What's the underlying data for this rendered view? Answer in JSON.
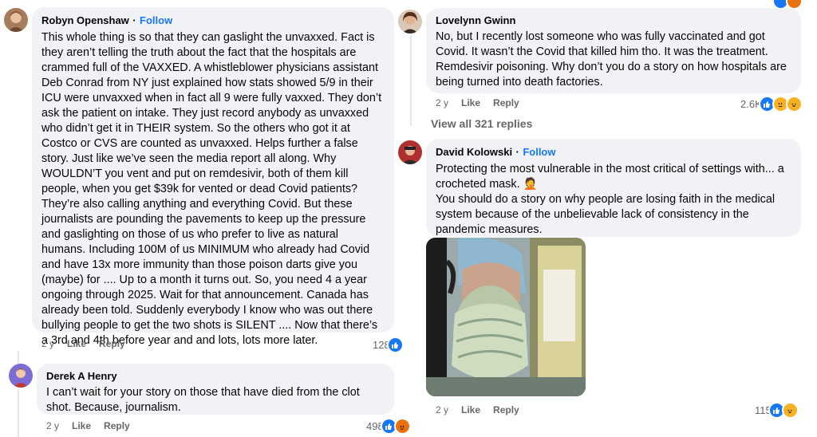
{
  "comments": {
    "robyn": {
      "author": "Robyn Openshaw",
      "separator": "·",
      "follow": "Follow",
      "text": "This whole thing is so that they can gaslight the unvaxxed. Fact is they aren’t telling the truth about the fact that the hospitals are crammed full of the VAXXED. A whistleblower physicians assistant Deb Conrad from NY just explained how stats showed 5/9 in their ICU were unvaxxed when in fact all 9 were fully vaxxed. They don’t ask the patient on intake. They just record anybody as unvaxxed who didn’t get it in THEIR system. So the others who got it at Costco or CVS are counted as unvaxxed. Helps further a false story. Just like we’ve seen the media report all along. Why WOULDN’T you vent and put on remdesivir, both of them kill people, when you get $39k for vented or dead Covid patients? They’re also calling anything and everything Covid. But these journalists are pounding the pavements to keep up the pressure and gaslighting on those of us who prefer to live as natural humans. Including 100M of us MINIMUM who already had Covid and have 13x more immunity than those poison darts give you (maybe) for .... Up to a month it turns out. So, you need 4 a year ongoing through 2025. Wait for that announcement. Canada has already been told. Suddenly everybody I know who was out there bullying people to get the two shots is SILENT .... Now that there’s a 3rd and 4th before year and and lots, lots more later.",
      "time": "2 y",
      "like": "Like",
      "reply": "Reply",
      "reactions_count": "128"
    },
    "derek": {
      "author": "Derek A Henry",
      "text": "I can’t wait for your story on those that have died from the clot shot. Because, journalism.",
      "time": "2 y",
      "like": "Like",
      "reply": "Reply",
      "reactions_count": "498"
    },
    "lovelynn": {
      "author": "Lovelynn Gwinn",
      "text": "No, but I recently lost someone who was fully vaccinated and got Covid. It wasn’t the Covid that killed him tho. It was the treatment. Remdesivir poisoning. Why don’t you do a story on how hospitals are being turned into death factories.",
      "time": "2 y",
      "like": "Like",
      "reply": "Reply",
      "reactions_count": "2.6K"
    },
    "view_replies": "View all 321 replies",
    "david": {
      "author": "David Kolowski",
      "separator": "·",
      "follow": "Follow",
      "text_line1": "Protecting the most vulnerable in the most critical of settings with... a crocheted mask. 🤦",
      "text_line2": "You should do a story on why people are losing faith in the medical system because of the unbelievable lack of consistency in the pandemic measures.",
      "time": "2 y",
      "like": "Like",
      "reply": "Reply",
      "reactions_count": "115"
    }
  },
  "icons": {
    "like": "like-reaction-icon",
    "haha": "haha-reaction-icon",
    "care": "care-reaction-icon",
    "angry": "angry-reaction-icon"
  },
  "colors": {
    "bubble": "#f0f2f5",
    "link": "#1877f2",
    "meta": "#65676b",
    "like": "#1877f2",
    "haha": "#f7b125"
  }
}
